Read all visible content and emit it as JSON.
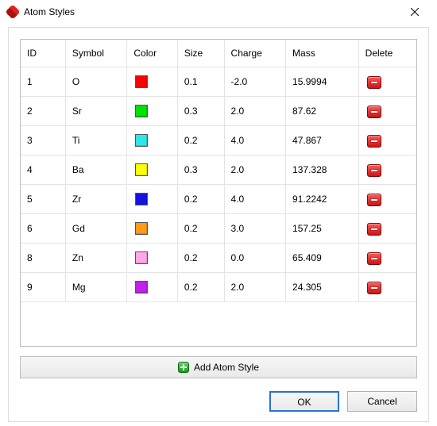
{
  "window": {
    "title": "Atom Styles"
  },
  "table": {
    "headers": {
      "id": "ID",
      "symbol": "Symbol",
      "color": "Color",
      "size": "Size",
      "charge": "Charge",
      "mass": "Mass",
      "delete": "Delete"
    },
    "rows": [
      {
        "id": "1",
        "symbol": "O",
        "color": "#ff0000",
        "size": "0.1",
        "charge": "-2.0",
        "mass": "15.9994"
      },
      {
        "id": "2",
        "symbol": "Sr",
        "color": "#00e000",
        "size": "0.3",
        "charge": "2.0",
        "mass": "87.62"
      },
      {
        "id": "3",
        "symbol": "Ti",
        "color": "#2ee6e6",
        "size": "0.2",
        "charge": "4.0",
        "mass": "47.867"
      },
      {
        "id": "4",
        "symbol": "Ba",
        "color": "#ffff00",
        "size": "0.3",
        "charge": "2.0",
        "mass": "137.328"
      },
      {
        "id": "5",
        "symbol": "Zr",
        "color": "#1414e0",
        "size": "0.2",
        "charge": "4.0",
        "mass": "91.2242"
      },
      {
        "id": "6",
        "symbol": "Gd",
        "color": "#ff9a1a",
        "size": "0.2",
        "charge": "3.0",
        "mass": "157.25"
      },
      {
        "id": "8",
        "symbol": "Zn",
        "color": "#ffa8e8",
        "size": "0.2",
        "charge": "0.0",
        "mass": "65.409"
      },
      {
        "id": "9",
        "symbol": "Mg",
        "color": "#c020e8",
        "size": "0.2",
        "charge": "2.0",
        "mass": "24.305"
      }
    ]
  },
  "buttons": {
    "add": "Add Atom Style",
    "ok": "OK",
    "cancel": "Cancel"
  }
}
